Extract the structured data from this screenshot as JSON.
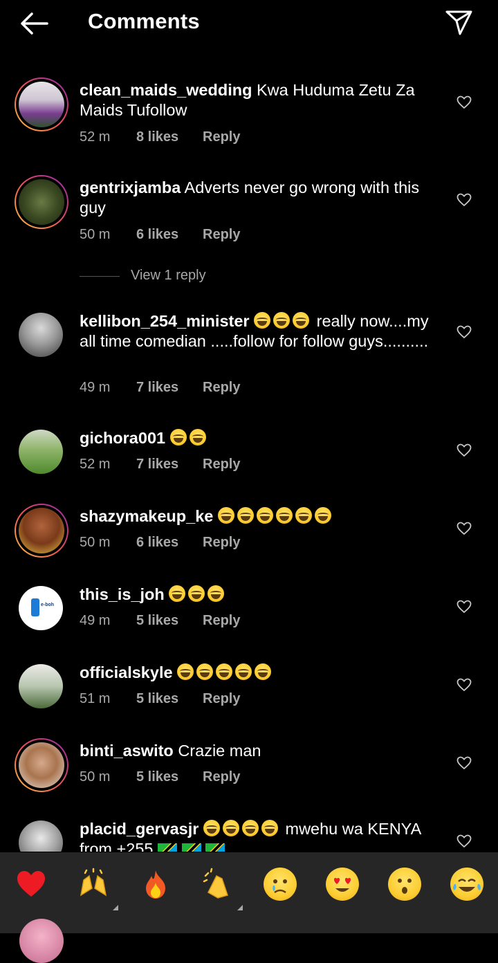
{
  "header": {
    "title": "Comments"
  },
  "comments": [
    {
      "username": "clean_maids_wedding",
      "text": "Kwa Huduma Zetu Za Maids Tufollow",
      "time": "52 m",
      "likes": "8 likes",
      "reply": "Reply"
    },
    {
      "username": "gentrixjamba",
      "text": "Adverts never go wrong with this guy",
      "time": "50 m",
      "likes": "6 likes",
      "reply": "Reply"
    },
    {
      "username": "kellibon_254_minister",
      "text": "really now....my all time comedian .....follow for follow guys..........",
      "time": "49 m",
      "likes": "7 likes",
      "reply": "Reply"
    },
    {
      "username": "gichora001",
      "text": "",
      "time": "52 m",
      "likes": "7 likes",
      "reply": "Reply"
    },
    {
      "username": "shazymakeup_ke",
      "text": "",
      "time": "50 m",
      "likes": "6 likes",
      "reply": "Reply"
    },
    {
      "username": "this_is_joh",
      "text": "",
      "time": "49 m",
      "likes": "5 likes",
      "reply": "Reply"
    },
    {
      "username": "officialskyle",
      "text": "",
      "time": "51 m",
      "likes": "5 likes",
      "reply": "Reply"
    },
    {
      "username": "binti_aswito",
      "text": "Crazie man",
      "time": "50 m",
      "likes": "5 likes",
      "reply": "Reply"
    },
    {
      "username": "placid_gervasjr",
      "text": "mwehu wa KENYA from +255",
      "time": "",
      "likes": "",
      "reply": ""
    }
  ],
  "view_replies": "View 1 reply",
  "avatar_logo_text": "e-boh",
  "reactions": [
    "heart",
    "raising-hands",
    "fire",
    "clapping-hands",
    "crying-face",
    "heart-eyes-face",
    "surprised-face",
    "tears-of-joy-face"
  ],
  "colors": {
    "background": "#000000",
    "secondary_text": "#a8a8a8",
    "reaction_bar": "#262626",
    "heart_red": "#ed1c24"
  }
}
